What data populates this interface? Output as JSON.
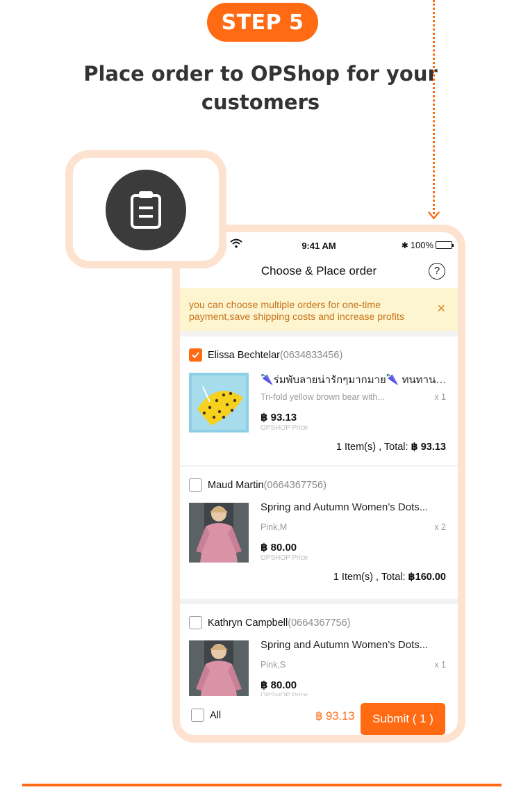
{
  "step": {
    "label": "STEP 5"
  },
  "headline": "Place order to OPShop for your customers",
  "status_bar": {
    "time": "9:41 AM",
    "battery": "100%"
  },
  "nav": {
    "title": "Choose & Place order",
    "help": "?"
  },
  "banner": {
    "text": "you can choose multiple orders for one-time payment,save shipping costs and increase profits",
    "close": "×"
  },
  "orders": [
    {
      "customer": "Elissa Bechtelar",
      "phone": "(0634833456)",
      "checked": true,
      "product_title": "🌂ร่มพับลายน่ารักๆมากมาย🌂 ทนทานแข็...",
      "variant": "Tri-fold yellow brown bear with...",
      "qty": "x 1",
      "price": "฿ 93.13",
      "price_label": "OPSHOP Price",
      "total_prefix": "1 Item(s) , Total: ",
      "total": "฿ 93.13"
    },
    {
      "customer": "Maud Martin",
      "phone": "(0664367756)",
      "checked": false,
      "product_title": "Spring and Autumn Women’s Dots...",
      "variant": "Pink,M",
      "qty": "x 2",
      "price": "฿ 80.00",
      "price_label": "OPSHOP Price",
      "total_prefix": "1 Item(s) , Total: ",
      "total": "฿160.00"
    },
    {
      "customer": "Kathryn Campbell",
      "phone": "(0664367756)",
      "checked": false,
      "product_title": "Spring and Autumn Women’s Dots...",
      "variant": "Pink,S",
      "qty": "x 1",
      "price": "฿ 80.00",
      "price_label": "OPSHOP Price"
    }
  ],
  "bottom": {
    "all_label": "All",
    "total": "฿ 93.13",
    "submit": "Submit ( 1 )"
  },
  "colors": {
    "accent": "#ff6a13",
    "frame": "#fde2cf",
    "banner_bg": "#fdf5cf",
    "banner_text": "#c8741d"
  },
  "icons": {
    "badge": "clipboard-icon"
  }
}
